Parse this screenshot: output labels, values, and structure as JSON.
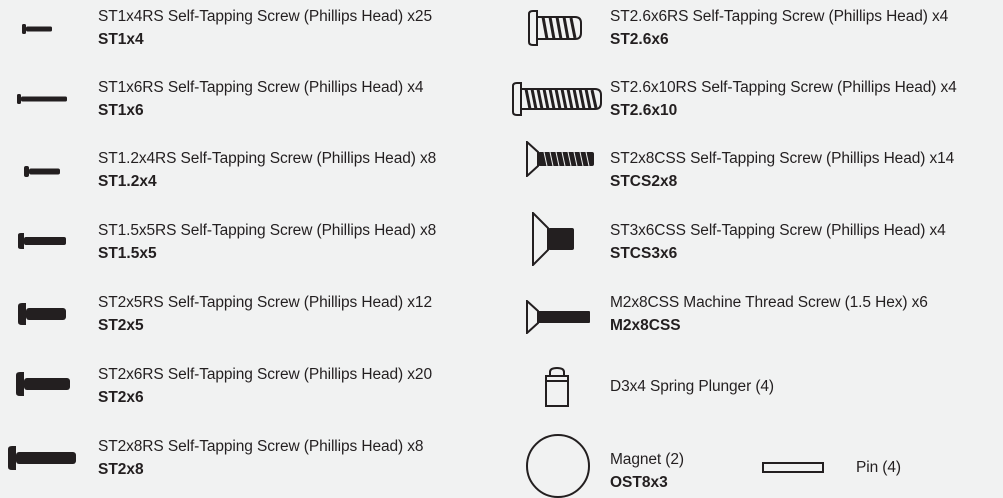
{
  "left_column": [
    {
      "description": "ST1x4RS Self-Tapping Screw (Phillips Head) x25",
      "code": "ST1x4",
      "icon": "screw-small-icon"
    },
    {
      "description": "ST1x6RS Self-Tapping Screw (Phillips Head) x4",
      "code": "ST1x6",
      "icon": "screw-small-icon"
    },
    {
      "description": "ST1.2x4RS Self-Tapping Screw (Phillips Head) x8",
      "code": "ST1.2x4",
      "icon": "screw-small-icon"
    },
    {
      "description": "ST1.5x5RS Self-Tapping Screw (Phillips Head) x8",
      "code": "ST1.5x5",
      "icon": "screw-icon"
    },
    {
      "description": "ST2x5RS Self-Tapping Screw (Phillips Head) x12",
      "code": "ST2x5",
      "icon": "screw-icon"
    },
    {
      "description": "ST2x6RS Self-Tapping Screw (Phillips Head) x20",
      "code": "ST2x6",
      "icon": "screw-icon"
    },
    {
      "description": "ST2x8RS Self-Tapping Screw (Phillips Head) x8",
      "code": "ST2x8",
      "icon": "screw-icon"
    }
  ],
  "right_column": [
    {
      "description": "ST2.6x6RS Self-Tapping Screw (Phillips Head) x4",
      "code": "ST2.6x6",
      "icon": "threaded-screw-icon"
    },
    {
      "description": "ST2.6x10RS Self-Tapping Screw (Phillips Head) x4",
      "code": "ST2.6x10",
      "icon": "threaded-screw-icon"
    },
    {
      "description": "ST2x8CSS Self-Tapping Screw (Phillips Head) x14",
      "code": "STCS2x8",
      "icon": "countersunk-screw-icon"
    },
    {
      "description": "ST3x6CSS Self-Tapping Screw (Phillips Head) x4",
      "code": "STCS3x6",
      "icon": "countersunk-screw-icon"
    },
    {
      "description": "M2x8CSS Machine Thread Screw (1.5 Hex) x6",
      "code": "M2x8CSS",
      "icon": "countersunk-screw-icon"
    },
    {
      "description": "D3x4 Spring Plunger (4)",
      "code": "",
      "icon": "spring-plunger-icon"
    },
    {
      "description": "Magnet (2)",
      "code": "OST8x3",
      "icon": "magnet-icon"
    }
  ],
  "pin": {
    "description": "Pin (4)",
    "icon": "pin-icon"
  }
}
